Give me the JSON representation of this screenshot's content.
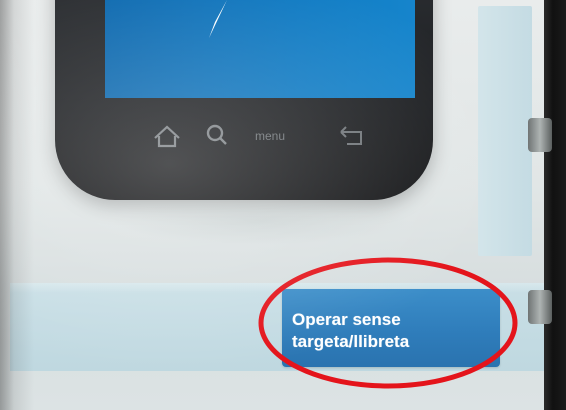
{
  "action_button": {
    "label": "Operar sense targeta/llibreta"
  },
  "phone_bar": {
    "menu_label": "menu"
  },
  "colors": {
    "button_blue": "#2f7dbb",
    "panel_blue": "#c9dfe6",
    "phone_screen_blue": "#0e79c2",
    "highlight_red": "#e4141b"
  },
  "icons": [
    "home-icon",
    "search-icon",
    "back-icon",
    "logo-icon"
  ]
}
